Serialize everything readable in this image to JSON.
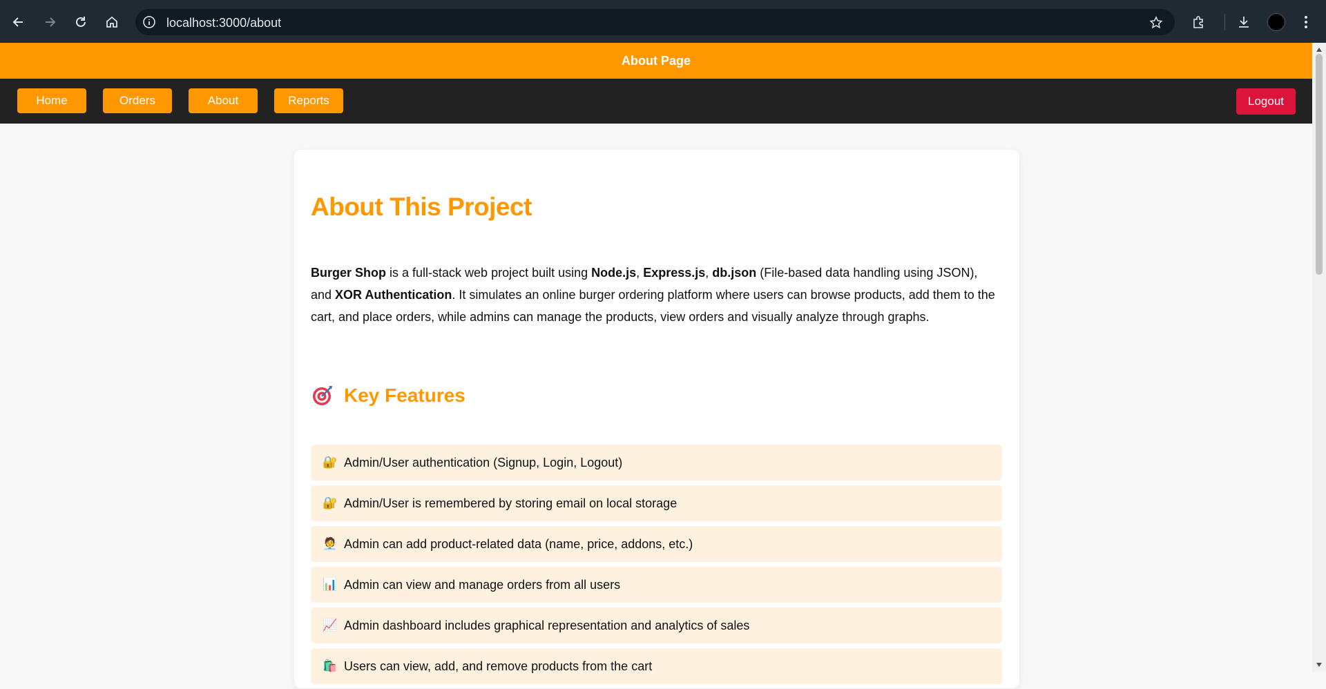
{
  "browser": {
    "url": "localhost:3000/about",
    "icons": [
      "back-icon",
      "forward-icon",
      "reload-icon",
      "home-icon",
      "site-info-icon",
      "bookmark-star-icon",
      "extensions-icon",
      "downloads-icon",
      "profile-avatar",
      "menu-kebab-icon"
    ]
  },
  "header": {
    "title": "About Page",
    "nav": [
      "Home",
      "Orders",
      "About",
      "Reports"
    ],
    "logout_label": "Logout",
    "accent_color": "#ff9800",
    "logout_color": "#dc143c"
  },
  "main": {
    "title": "About This Project",
    "intro": {
      "brand": "Burger Shop",
      "t1": " is a full-stack web project built using ",
      "node": "Node.js",
      "c1": ", ",
      "express": "Express.js",
      "c2": ", ",
      "db": "db.json",
      "t2": " (File-based data handling using JSON), and ",
      "xor": "XOR Authentication",
      "t3": ". It simulates an online burger ordering platform where users can browse products, add them to the cart, and place orders, while admins can manage the products, view orders and visually analyze through graphs."
    },
    "features_heading": "Key Features",
    "features": [
      {
        "emoji": "🔐",
        "icon": "lock-icon",
        "text": "Admin/User authentication (Signup, Login, Logout)"
      },
      {
        "emoji": "🔐",
        "icon": "lock-icon",
        "text": "Admin/User is remembered by storing email on local storage"
      },
      {
        "emoji": "🧑‍💼",
        "icon": "admin-person-icon",
        "text": "Admin can add product-related data (name, price, addons, etc.)"
      },
      {
        "emoji": "📊",
        "icon": "bar-chart-icon",
        "text": "Admin can view and manage orders from all users"
      },
      {
        "emoji": "📈",
        "icon": "trend-chart-icon",
        "text": "Admin dashboard includes graphical representation and analytics of sales"
      },
      {
        "emoji": "🛍️",
        "icon": "shopping-bag-icon",
        "text": "Users can view, add, and remove products from the cart"
      }
    ]
  }
}
